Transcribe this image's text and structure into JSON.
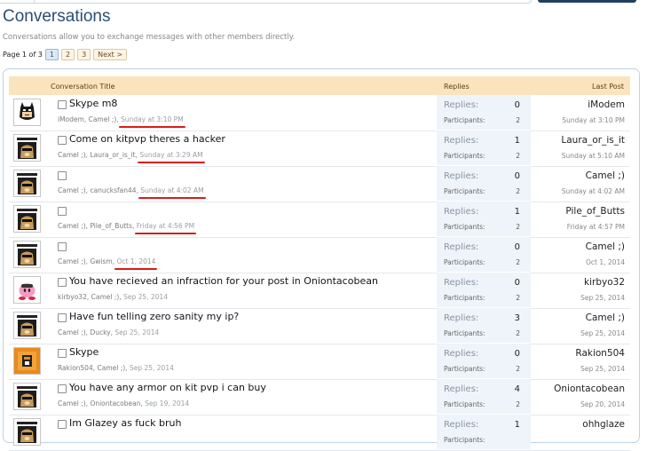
{
  "page": {
    "title": "Conversations",
    "description": "Conversations allow you to exchange messages with other members directly."
  },
  "pagination": {
    "label": "Page 1 of 3",
    "pages": [
      "1",
      "2",
      "3"
    ],
    "current": "1",
    "next_label": "Next >"
  },
  "table": {
    "headers": {
      "title": "Conversation Title",
      "replies": "Replies",
      "last_post": "Last Post"
    },
    "replies_label": "Replies:",
    "participants_label": "Participants:"
  },
  "rows": [
    {
      "title": "Skype m8",
      "participants": "iModem, Camel ;),",
      "date": "Sunday at 3:10 PM",
      "replies": "0",
      "participant_count": "2",
      "last_user": "iModem",
      "last_date": "Sunday at 3:10 PM",
      "avatar": "batman-avatar-icon"
    },
    {
      "title": "Come on kitpvp theres a hacker",
      "participants": "Camel ;), Laura_or_is_it,",
      "date": "Sunday at 3:29 AM",
      "replies": "1",
      "participant_count": "2",
      "last_user": "Laura_or_is_it",
      "last_date": "Sunday at 5:10 AM",
      "avatar": "doge-avatar-icon"
    },
    {
      "title": "",
      "participants": "Camel ;), canucksfan44,",
      "date": "Sunday at 4:02 AM",
      "replies": "0",
      "participant_count": "2",
      "last_user": "Camel ;)",
      "last_date": "Sunday at 4:02 AM",
      "avatar": "doge-avatar-icon"
    },
    {
      "title": "",
      "participants": "Camel ;), Pile_of_Butts,",
      "date": "Friday at 4:56 PM",
      "replies": "1",
      "participant_count": "2",
      "last_user": "Pile_of_Butts",
      "last_date": "Friday at 4:57 PM",
      "avatar": "doge-avatar-icon"
    },
    {
      "title": "",
      "participants": "Camel ;), Gwism,",
      "date": "Oct 1, 2014",
      "replies": "0",
      "participant_count": "2",
      "last_user": "Camel ;)",
      "last_date": "Oct 1, 2014",
      "avatar": "doge-avatar-icon"
    },
    {
      "title": "You have recieved an infraction for your post in Oniontacobean",
      "participants": "kirbyo32, Camel ;),",
      "date": "Sep 25, 2014",
      "replies": "0",
      "participant_count": "2",
      "last_user": "kirbyo32",
      "last_date": "Sep 25, 2014",
      "avatar": "kirby-avatar-icon"
    },
    {
      "title": "Have fun telling zero sanity my ip?",
      "participants": "Camel ;), Ducky,",
      "date": "Sep 25, 2014",
      "replies": "3",
      "participant_count": "2",
      "last_user": "Camel ;)",
      "last_date": "Sep 25, 2014",
      "avatar": "doge-avatar-icon"
    },
    {
      "title": "Skype",
      "participants": "Rakion504, Camel ;),",
      "date": "Sep 25, 2014",
      "replies": "0",
      "participant_count": "2",
      "last_user": "Rakion504",
      "last_date": "Sep 25, 2014",
      "avatar": "orange-avatar-icon"
    },
    {
      "title": "You have any armor on kit pvp i can buy",
      "participants": "Camel ;), Oniontacobean,",
      "date": "Sep 19, 2014",
      "replies": "4",
      "participant_count": "2",
      "last_user": "Oniontacobean",
      "last_date": "Sep 20, 2014",
      "avatar": "doge-avatar-icon"
    },
    {
      "title": "Im Glazey as fuck bruh",
      "participants": "",
      "date": "",
      "replies": "1",
      "participant_count": "",
      "last_user": "ohhglaze",
      "last_date": "",
      "avatar": "doge-avatar-icon"
    }
  ],
  "colors": {
    "title": "#2b4f72",
    "header_bg": "#fbe3bd",
    "stats_bg": "#eef4fa",
    "annotation_red": "#d81c1c"
  }
}
